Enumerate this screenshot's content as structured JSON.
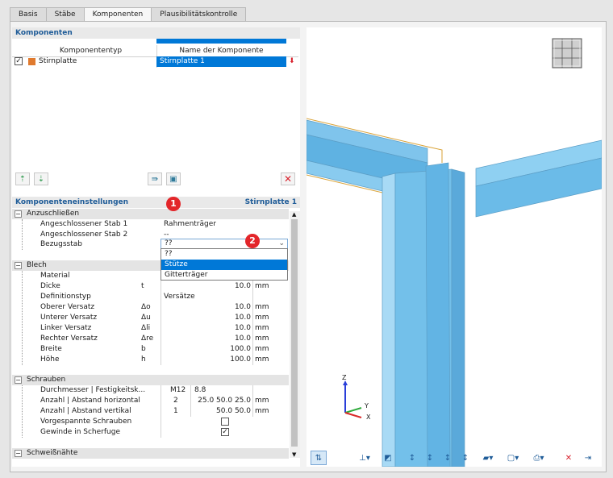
{
  "tabs": [
    {
      "label": "Basis"
    },
    {
      "label": "Stäbe"
    },
    {
      "label": "Komponenten"
    },
    {
      "label": "Plausibilitätskontrolle"
    }
  ],
  "components": {
    "title": "Komponenten",
    "col_type": "Komponententyp",
    "col_name": "Name der Komponente",
    "rows": [
      {
        "type": "Stirnplatte",
        "name": "Stirnplatte 1",
        "checked": true,
        "color": "#e07a2e"
      }
    ]
  },
  "settings": {
    "title": "Komponenteneinstellungen",
    "current": "Stirnplatte 1",
    "groups": {
      "anschliessen": {
        "label": "Anzuschließen",
        "rows": [
          {
            "name": "Angeschlossener Stab 1",
            "value": "Rahmenträger"
          },
          {
            "name": "Angeschlossener Stab 2",
            "value": "--"
          },
          {
            "name": "Bezugsstab",
            "value": "??"
          }
        ]
      },
      "blech": {
        "label": "Blech",
        "rows": [
          {
            "name": "Material",
            "sym": "",
            "value": "",
            "unit": ""
          },
          {
            "name": "Dicke",
            "sym": "t",
            "value": "10.0",
            "unit": "mm"
          },
          {
            "name": "Definitionstyp",
            "sym": "",
            "value": "Versätze",
            "unit": ""
          },
          {
            "name": "Oberer Versatz",
            "sym": "Δo",
            "value": "10.0",
            "unit": "mm"
          },
          {
            "name": "Unterer Versatz",
            "sym": "Δu",
            "value": "10.0",
            "unit": "mm"
          },
          {
            "name": "Linker Versatz",
            "sym": "Δli",
            "value": "10.0",
            "unit": "mm"
          },
          {
            "name": "Rechter Versatz",
            "sym": "Δre",
            "value": "10.0",
            "unit": "mm"
          },
          {
            "name": "Breite",
            "sym": "b",
            "value": "100.0",
            "unit": "mm"
          },
          {
            "name": "Höhe",
            "sym": "h",
            "value": "100.0",
            "unit": "mm"
          }
        ]
      },
      "schrauben": {
        "label": "Schrauben",
        "rows": [
          {
            "name": "Durchmesser | Festigkeitsk...",
            "a": "M12",
            "b": "8.8",
            "unit": ""
          },
          {
            "name": "Anzahl | Abstand horizontal",
            "a": "2",
            "b": "25.0 50.0 25.0",
            "unit": "mm"
          },
          {
            "name": "Anzahl | Abstand vertikal",
            "a": "1",
            "b": "50.0 50.0",
            "unit": "mm"
          },
          {
            "name": "Vorgespannte Schrauben",
            "checked": false
          },
          {
            "name": "Gewinde in Scherfuge",
            "checked": true
          }
        ]
      },
      "schweiss": {
        "label": "Schweißnähte"
      }
    }
  },
  "dropdown": {
    "value": "??",
    "options": [
      {
        "label": "??"
      },
      {
        "label": "Stütze"
      },
      {
        "label": "Gitterträger"
      }
    ],
    "selected_option": "Stütze"
  },
  "badges": [
    {
      "text": "1"
    },
    {
      "text": "2"
    }
  ],
  "axes": {
    "x": "X",
    "y": "Y",
    "z": "Z"
  },
  "colors": {
    "accent": "#0078d7",
    "section_title": "#1f5c98",
    "steel": "#7fc4ec",
    "delete": "#d9232e"
  }
}
